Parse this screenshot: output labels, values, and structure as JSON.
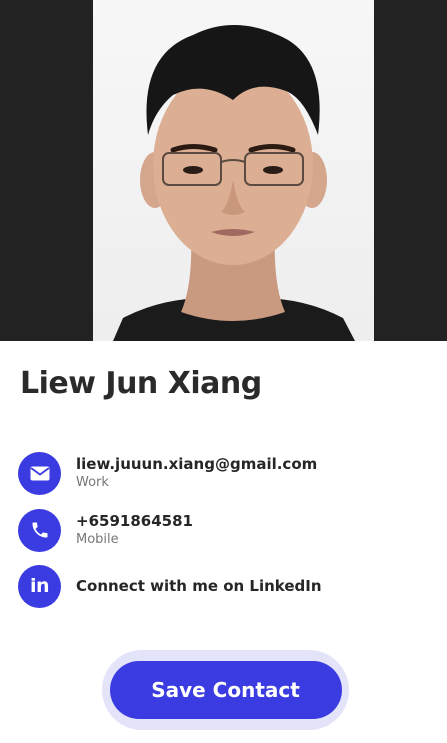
{
  "profile": {
    "name": "Liew Jun Xiang"
  },
  "contacts": [
    {
      "icon": "envelope-icon",
      "primary": "liew.juuun.xiang@gmail.com",
      "secondary": "Work"
    },
    {
      "icon": "phone-icon",
      "primary": "+6591864581",
      "secondary": "Mobile"
    },
    {
      "icon": "linkedin-icon",
      "primary": "Connect with me on LinkedIn",
      "secondary": ""
    }
  ],
  "actions": {
    "save_label": "Save Contact"
  },
  "colors": {
    "accent": "#3a3be0",
    "accent_light": "#e3e3fa",
    "hero_bg": "#222222"
  }
}
